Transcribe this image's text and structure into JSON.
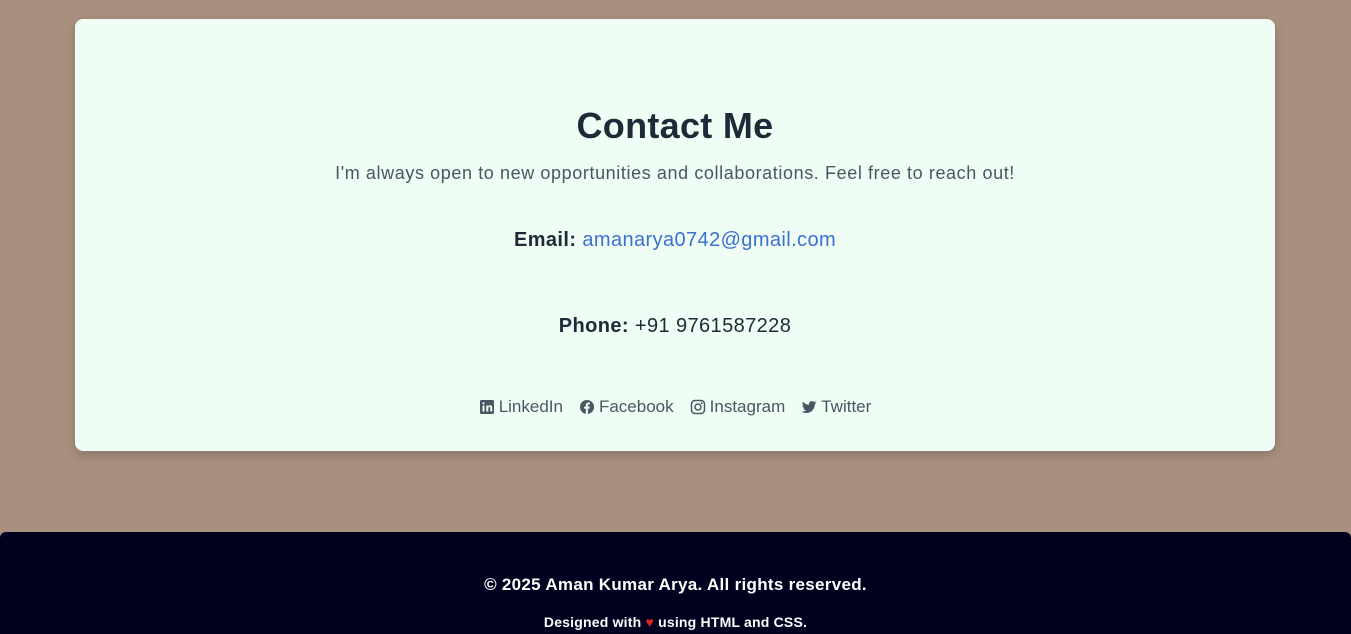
{
  "contact": {
    "title": "Contact Me",
    "subtitle": "I'm always open to new opportunities and collaborations. Feel free to reach out!",
    "email_label": "Email:",
    "email_value": "amanarya0742@gmail.com",
    "phone_label": "Phone:",
    "phone_value": "+91 9761587228"
  },
  "socials": [
    {
      "label": "LinkedIn",
      "icon": "linkedin-icon"
    },
    {
      "label": "Facebook",
      "icon": "facebook-icon"
    },
    {
      "label": "Instagram",
      "icon": "instagram-icon"
    },
    {
      "label": "Twitter",
      "icon": "twitter-icon"
    }
  ],
  "footer": {
    "copyright": "© 2025 Aman Kumar Arya. All rights reserved.",
    "designed_prefix": "Designed with",
    "heart": "♥",
    "designed_suffix": "using HTML and CSS."
  },
  "colors": {
    "page_bg": "#a98f7e",
    "card_bg": "#f0fdf4",
    "link": "#3b6fd4",
    "footer_bg": "#00001f",
    "heart": "#dc2626"
  }
}
